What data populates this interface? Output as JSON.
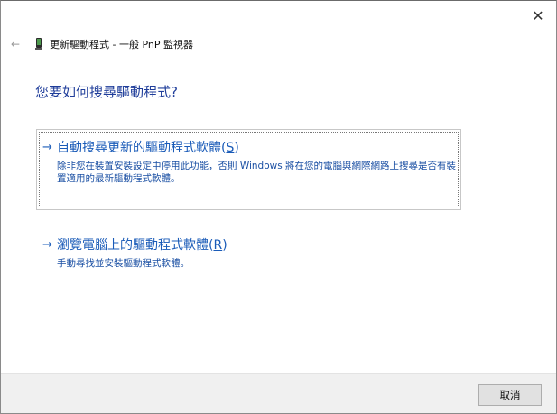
{
  "window": {
    "close_glyph": "✕",
    "back_glyph": "←",
    "title": "更新驅動程式 - 一般 PnP 監視器"
  },
  "main": {
    "question": "您要如何搜尋驅動程式?",
    "options": [
      {
        "arrow": "→",
        "label": "自動搜尋更新的驅動程式軟體(",
        "accel": "S",
        "label_end": ")",
        "description": "除非您在裝置安裝設定中停用此功能，否則 Windows 將在您的電腦與網際網路上搜尋是否有裝置適用的最新驅動程式軟體。"
      },
      {
        "arrow": "→",
        "label": "瀏覽電腦上的驅動程式軟體(",
        "accel": "R",
        "label_end": ")",
        "description": "手動尋找並安裝驅動程式軟體。"
      }
    ]
  },
  "footer": {
    "cancel_label": "取消"
  },
  "icons": {
    "device": "monitor-device-icon"
  },
  "colors": {
    "link": "#1a5bb8",
    "heading": "#1f3d9a",
    "footer_bg": "#f0f0f0"
  }
}
